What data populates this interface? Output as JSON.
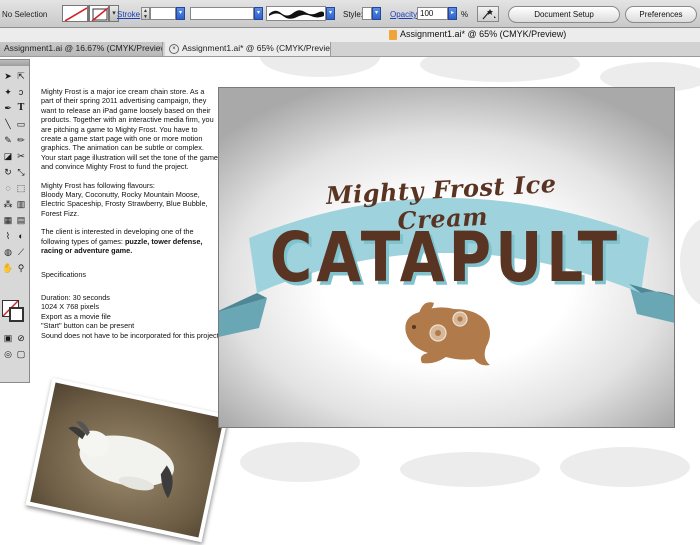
{
  "control_bar": {
    "selection_status": "No Selection",
    "stroke_label": "Stroke",
    "style_label": "Style:",
    "opacity_label": "Opacity",
    "opacity_value": "100",
    "opacity_unit": "%",
    "document_setup_label": "Document Setup",
    "preferences_label": "Preferences"
  },
  "window": {
    "title": "Assignment1.ai* @ 65% (CMYK/Preview)"
  },
  "tabs": [
    {
      "label": "Assignment1.ai @ 16.67% (CMYK/Preview)"
    },
    {
      "label": "Assignment1.ai* @ 65% (CMYK/Preview)"
    }
  ],
  "brief": {
    "p1": "Mighty Frost is a major ice cream chain store. As a part of their spring 2011 advertising campaign, they want to release an iPad game loosely based on their products. Together with an interactive media firm, you are pitching a game to Mighty Frost. You have to create a game start page with one or more motion graphics. The animation can be subtle or complex. Your start page illustration will set the tone of the game and convince Mighty Frost to fund the project.",
    "flavours_heading": "Mighty Frost has following flavours:",
    "flavours_list": "Bloody Mary, Coconutty, Rocky Mountain Moose, Electric Spaceship, Frosty Strawberry, Blue Bubble, Forest Fizz.",
    "p3_start": "The client is interested in developing one of the following types of games: ",
    "p3_bold": "puzzle, tower defense, racing or adventure game.",
    "specs_heading": "Specifications",
    "spec_duration": "Duration: 30 seconds",
    "spec_size": "1024 X 768 pixels",
    "spec_export": "Export as a movie file",
    "spec_start": "\"Start\" button can be present",
    "spec_sound": "Sound does not have to be incorporated for this project"
  },
  "artwork": {
    "banner_text": "Mighty Frost Ice Cream",
    "main_text": "CATAPULT"
  },
  "colors": {
    "brown": "#5a3422",
    "banner_blue": "#9ed3de",
    "rabbit": "#b07a4b",
    "link_blue": "#1b3fb5"
  },
  "icons": {
    "tools": [
      "selection-arrow",
      "direct-selection",
      "magic-wand",
      "lasso",
      "pen",
      "type",
      "line",
      "rectangle",
      "paintbrush",
      "pencil",
      "eraser",
      "rotate",
      "scale",
      "warp",
      "free-transform",
      "symbol-sprayer",
      "graph",
      "mesh",
      "gradient",
      "eyedropper",
      "blend",
      "live-paint",
      "slice",
      "scissors",
      "hand",
      "zoom"
    ]
  }
}
